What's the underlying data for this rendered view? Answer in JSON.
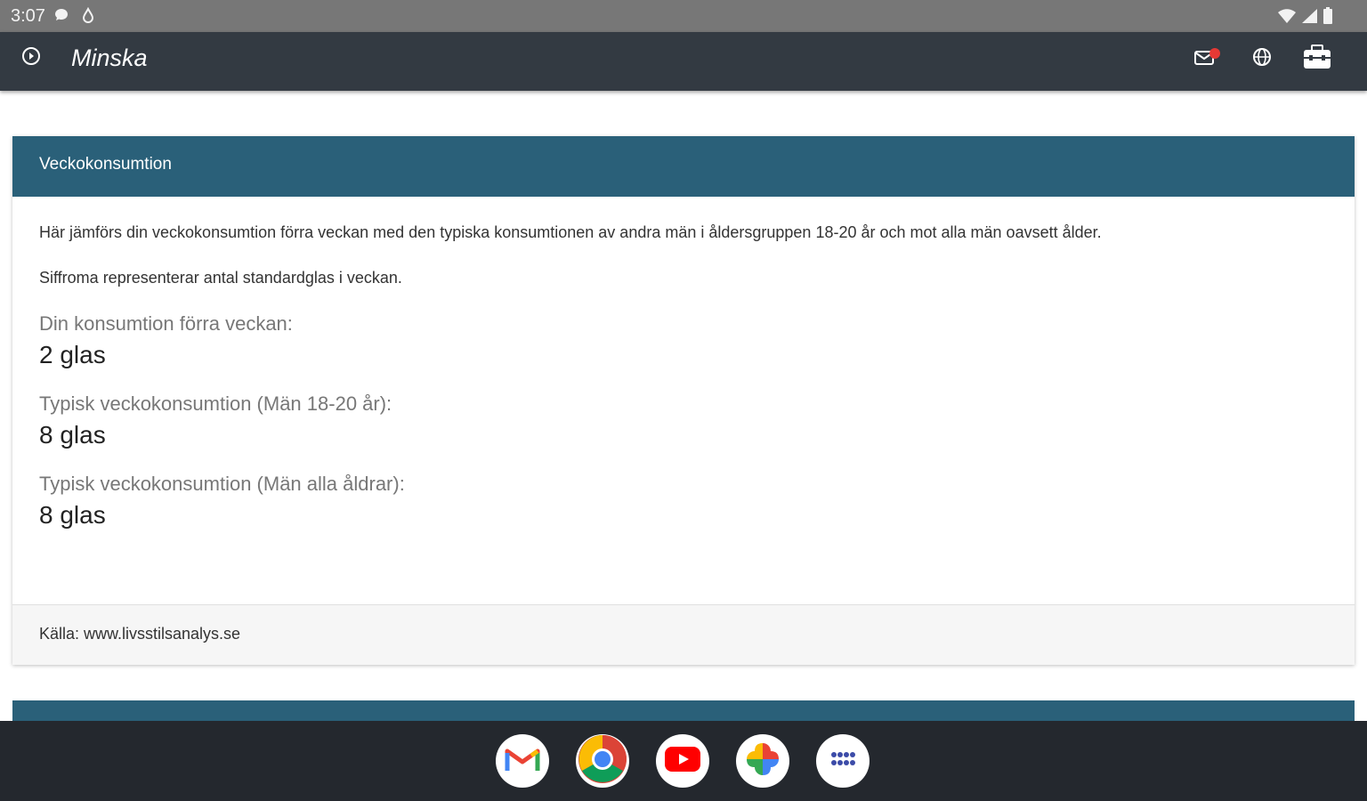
{
  "status_bar": {
    "time": "3:07",
    "icons": [
      "chat-bubble-icon",
      "drop-icon",
      "wifi-icon",
      "signal-icon",
      "battery-icon"
    ]
  },
  "app_bar": {
    "title": "Minska",
    "icons": [
      "menu-circle-icon",
      "mail-notification-icon",
      "globe-icon",
      "briefcase-icon"
    ]
  },
  "card": {
    "header": "Veckokonsumtion",
    "intro": "Här jämförs din veckokonsumtion förra veckan med den typiska konsumtionen av andra män i åldersgruppen 18-20 år och mot alla män oavsett ålder.",
    "note": "Siffroma representerar antal standardglas i veckan.",
    "stats": [
      {
        "label": "Din konsumtion förra veckan:",
        "value": "2 glas"
      },
      {
        "label": "Typisk veckokonsumtion (Män 18-20 år):",
        "value": "8 glas"
      },
      {
        "label": "Typisk veckokonsumtion (Män alla åldrar):",
        "value": "8 glas"
      }
    ],
    "footer": "Källa: www.livsstilsanalys.se"
  },
  "dock": {
    "apps": [
      "gmail-icon",
      "chrome-icon",
      "youtube-icon",
      "photos-icon",
      "app-drawer-icon"
    ]
  },
  "colors": {
    "status_bar": "#777777",
    "app_bar": "#333a42",
    "card_header": "#2a6079",
    "dock": "#24282e"
  }
}
